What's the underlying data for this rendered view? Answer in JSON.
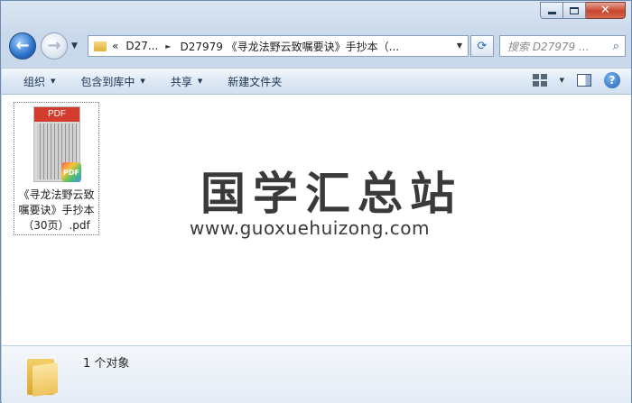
{
  "window": {
    "minimize_glyph": "minimize-icon",
    "maximize_glyph": "maximize-icon",
    "close_glyph": "✕"
  },
  "nav": {
    "back_glyph": "←",
    "forward_glyph": "→",
    "address": {
      "prefix": "«",
      "crumbs": [
        "D27...",
        "D27979 《寻龙法野云致嘱要诀》手抄本（..."
      ],
      "separator": "►",
      "dropdown_glyph": "▼"
    },
    "refresh_glyph": "⟳",
    "search": {
      "placeholder": "搜索 D27979 ...",
      "icon_glyph": "⌕"
    }
  },
  "commands": {
    "organize": "组织",
    "include_in_library": "包含到库中",
    "share": "共享",
    "new_folder": "新建文件夹"
  },
  "file": {
    "thumb_label": "PDF",
    "badge_label": "PDF",
    "name": "《寻龙法野云致嘱要诀》手抄本（30页）.pdf"
  },
  "watermark": {
    "title": "国学汇总站",
    "url": "www.guoxuehuizong.com"
  },
  "details": {
    "count_text": "1 个对象"
  },
  "colors": {
    "accent_blue": "#2a6fc7",
    "close_red": "#c8452c",
    "pdf_red": "#d33b2c"
  }
}
